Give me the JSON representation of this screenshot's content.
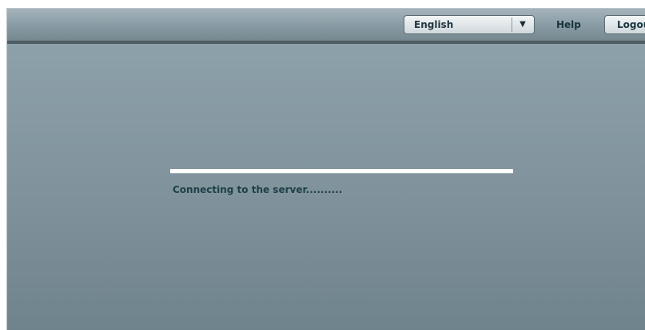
{
  "header": {
    "language": {
      "selected": "English",
      "arrow_icon": "dropdown-arrow-icon"
    },
    "help_label": "Help",
    "logout_label": "Logout"
  },
  "main": {
    "progress": {
      "value": 1.0
    },
    "status_text": "Connecting to the server.........."
  }
}
